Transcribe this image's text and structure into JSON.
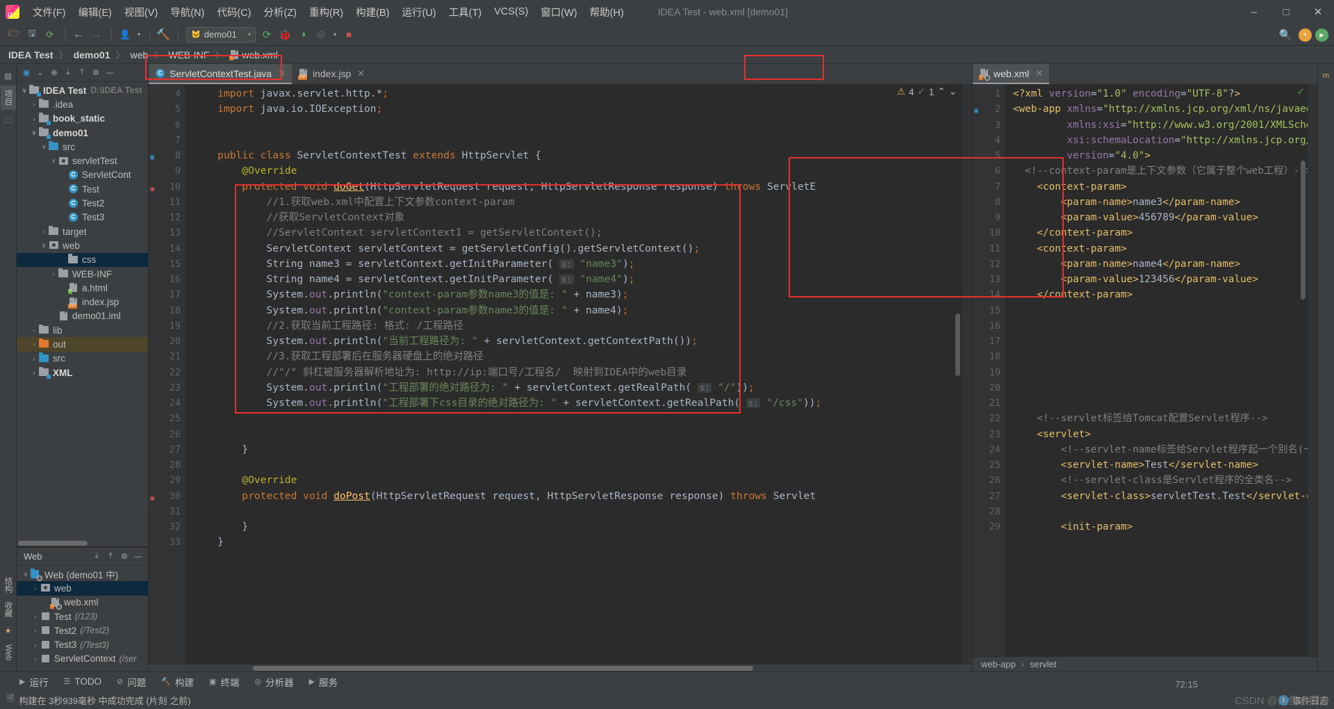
{
  "window": {
    "title": "IDEA Test - web.xml [demo01]",
    "controls": {
      "minimize": "–",
      "maximize": "□",
      "close": "✕"
    }
  },
  "menubar": {
    "logo_icon": "intellij-idea-logo",
    "items": [
      "文件(F)",
      "编辑(E)",
      "视图(V)",
      "导航(N)",
      "代码(C)",
      "分析(Z)",
      "重构(R)",
      "构建(B)",
      "运行(U)",
      "工具(T)",
      "VCS(S)",
      "窗口(W)",
      "帮助(H)"
    ]
  },
  "toolbar": {
    "icons": [
      "open-folder-icon",
      "save-icon",
      "sync-icon"
    ],
    "nav_back_icon": "arrow-left-icon",
    "nav_forward_icon": "arrow-right-icon",
    "profile_icon": "user-icon",
    "build_icon": "hammer-icon",
    "run_config": {
      "label": "demo01",
      "icon": "tomcat-icon",
      "caret": "▾"
    },
    "run_icon": "run-icon",
    "debug_icon": "debug-icon",
    "coverage_icon": "coverage-icon",
    "profiler_icon": "profiler-icon",
    "stop_icon": "stop-icon",
    "search_icon": "search-icon",
    "update_badge": "+",
    "ide_badge": "▶"
  },
  "breadcrumb": {
    "items": [
      "IDEA Test",
      "demo01",
      "web",
      "WEB-INF",
      "web.xml"
    ],
    "separator": "〉"
  },
  "left_strip": {
    "tabs": [
      "项目",
      "结构",
      "收藏",
      "Web"
    ],
    "icons": [
      "project-icon",
      "structure-icon",
      "favorites-icon",
      "web-icon"
    ]
  },
  "project_panel": {
    "title": "项目",
    "header_icons": [
      "select-target-icon",
      "scope-icon",
      "locate-icon",
      "expand-all-icon",
      "collapse-all-icon",
      "settings-gear-icon",
      "hide-icon"
    ],
    "tree": [
      {
        "label": "IDEA Test",
        "suffix": "D:\\IDEA Test",
        "indent": 0,
        "arrow": "∨",
        "icon": "module-folder-icon",
        "bold": true
      },
      {
        "label": ".idea",
        "indent": 1,
        "arrow": "›",
        "icon": "folder-icon"
      },
      {
        "label": "book_static",
        "indent": 1,
        "arrow": "›",
        "icon": "module-folder-icon",
        "bold": true
      },
      {
        "label": "demo01",
        "indent": 1,
        "arrow": "∨",
        "icon": "module-folder-icon",
        "bold": true
      },
      {
        "label": "src",
        "indent": 2,
        "arrow": "∨",
        "icon": "source-folder-icon"
      },
      {
        "label": "servletTest",
        "indent": 3,
        "arrow": "∨",
        "icon": "package-icon"
      },
      {
        "label": "ServletCont",
        "indent": 4,
        "arrow": "",
        "icon": "java-class-icon"
      },
      {
        "label": "Test",
        "indent": 4,
        "arrow": "",
        "icon": "java-class-icon"
      },
      {
        "label": "Test2",
        "indent": 4,
        "arrow": "",
        "icon": "java-class-icon"
      },
      {
        "label": "Test3",
        "indent": 4,
        "arrow": "",
        "icon": "java-class-icon"
      },
      {
        "label": "target",
        "indent": 2,
        "arrow": "›",
        "icon": "folder-icon"
      },
      {
        "label": "web",
        "indent": 2,
        "arrow": "∨",
        "icon": "web-folder-icon"
      },
      {
        "label": "css",
        "indent": 4,
        "arrow": "",
        "icon": "folder-icon",
        "selected": true
      },
      {
        "label": "WEB-INF",
        "indent": 3,
        "arrow": "›",
        "icon": "folder-icon"
      },
      {
        "label": "a.html",
        "indent": 4,
        "arrow": "",
        "icon": "html-file-icon"
      },
      {
        "label": "index.jsp",
        "indent": 4,
        "arrow": "",
        "icon": "jsp-file-icon"
      },
      {
        "label": "demo01.iml",
        "indent": 3,
        "arrow": "",
        "icon": "iml-file-icon"
      },
      {
        "label": "lib",
        "indent": 1,
        "arrow": "›",
        "icon": "folder-icon"
      },
      {
        "label": "out",
        "indent": 1,
        "arrow": "›",
        "icon": "output-folder-icon",
        "highlighted": true
      },
      {
        "label": "src",
        "indent": 1,
        "arrow": "›",
        "icon": "source-folder-icon"
      },
      {
        "label": "XML",
        "indent": 1,
        "arrow": "›",
        "icon": "module-folder-icon",
        "bold": true
      }
    ]
  },
  "web_panel": {
    "title": "Web",
    "header_icons": [
      "expand-all-icon",
      "collapse-all-icon",
      "settings-gear-icon",
      "hide-icon"
    ],
    "tree": [
      {
        "label": "Web (demo01 中)",
        "indent": 0,
        "arrow": "∨",
        "icon": "web-module-icon"
      },
      {
        "label": "web",
        "indent": 1,
        "arrow": "›",
        "icon": "web-folder-icon",
        "selected": true
      },
      {
        "label": "web.xml",
        "indent": 2,
        "arrow": "",
        "icon": "webxml-file-icon"
      },
      {
        "label": "Test",
        "mapping": "(/123)",
        "indent": 1,
        "arrow": "›",
        "icon": "servlet-icon"
      },
      {
        "label": "Test2",
        "mapping": "(/Test2)",
        "indent": 1,
        "arrow": "›",
        "icon": "servlet-icon"
      },
      {
        "label": "Test3",
        "mapping": "(/Test3)",
        "indent": 1,
        "arrow": "›",
        "icon": "servlet-icon"
      },
      {
        "label": "ServletContext",
        "mapping": "(/ser",
        "indent": 1,
        "arrow": "›",
        "icon": "servlet-icon"
      }
    ]
  },
  "editor_left": {
    "tabs": [
      {
        "label": "ServletContextTest.java",
        "icon": "java-class-icon",
        "active": true,
        "close": "✕"
      },
      {
        "label": "index.jsp",
        "icon": "jsp-file-icon",
        "active": false,
        "close": "✕"
      }
    ],
    "inspections": {
      "warning_count": "4",
      "warning_icon": "warning-triangle-icon",
      "ok_count": "1",
      "ok_icon": "check-icon",
      "up_icon": "⌃",
      "down_icon": "⌄"
    },
    "first_line_number": 4,
    "lines": [
      {
        "n": 4,
        "text": "    import javax.servlet.http.*;"
      },
      {
        "n": 5,
        "text": "    import java.io.IOException;"
      },
      {
        "n": 6,
        "text": ""
      },
      {
        "n": 7,
        "text": ""
      },
      {
        "n": 8,
        "text": "    public class ServletContextTest extends HttpServlet {"
      },
      {
        "n": 9,
        "text": "        @Override"
      },
      {
        "n": 10,
        "text": "        protected void doGet(HttpServletRequest request, HttpServletResponse response) throws ServletE"
      },
      {
        "n": 11,
        "text": "            //1.获取web.xml中配置上下文参数context-param"
      },
      {
        "n": 12,
        "text": "            //获取ServletContext对象"
      },
      {
        "n": 13,
        "text": "            //ServletContext servletContext1 = getServletContext();"
      },
      {
        "n": 14,
        "text": "            ServletContext servletContext = getServletConfig().getServletContext();"
      },
      {
        "n": 15,
        "text": "            String name3 = servletContext.getInitParameter( s: \"name3\");"
      },
      {
        "n": 16,
        "text": "            String name4 = servletContext.getInitParameter( s: \"name4\");"
      },
      {
        "n": 17,
        "text": "            System.out.println(\"context-param参数name3的值是: \" + name3);"
      },
      {
        "n": 18,
        "text": "            System.out.println(\"context-param参数name3的值是: \" + name4);"
      },
      {
        "n": 19,
        "text": "            //2.获取当前工程路径: 格式: /工程路径"
      },
      {
        "n": 20,
        "text": "            System.out.println(\"当前工程路径为: \" + servletContext.getContextPath());"
      },
      {
        "n": 21,
        "text": "            //3.获取工程部署后在服务器硬盘上的绝对路径"
      },
      {
        "n": 22,
        "text": "            //\"/\" 斜杠被服务器解析地址为: http://ip:端口号/工程名/  映射到IDEA中的web目录"
      },
      {
        "n": 23,
        "text": "            System.out.println(\"工程部署的绝对路径为: \" + servletContext.getRealPath( s: \"/\"));"
      },
      {
        "n": 24,
        "text": "            System.out.println(\"工程部署下css目录的绝对路径为: \" + servletContext.getRealPath( s: \"/css\"));"
      },
      {
        "n": 25,
        "text": ""
      },
      {
        "n": 26,
        "text": ""
      },
      {
        "n": 27,
        "text": "        }"
      },
      {
        "n": 28,
        "text": ""
      },
      {
        "n": 29,
        "text": "        @Override"
      },
      {
        "n": 30,
        "text": "        protected void doPost(HttpServletRequest request, HttpServletResponse response) throws Servlet"
      },
      {
        "n": 31,
        "text": ""
      },
      {
        "n": 32,
        "text": "        }"
      },
      {
        "n": 33,
        "text": "    }"
      }
    ]
  },
  "editor_right": {
    "tabs": [
      {
        "label": "web.xml",
        "icon": "webxml-file-icon",
        "active": true,
        "close": "✕"
      }
    ],
    "ok_icon": "check-icon",
    "lines": [
      {
        "n": 1,
        "text": "<?xml version=\"1.0\" encoding=\"UTF-8\"?>"
      },
      {
        "n": 2,
        "text": "<web-app xmlns=\"http://xmlns.jcp.org/xml/ns/javaee"
      },
      {
        "n": 3,
        "text": "         xmlns:xsi=\"http://www.w3.org/2001/XMLSche"
      },
      {
        "n": 4,
        "text": "         xsi:schemaLocation=\"http://xmlns.jcp.org/"
      },
      {
        "n": 5,
        "text": "         version=\"4.0\">"
      },
      {
        "n": 6,
        "text": "  <!--context-param是上下文参数（它属于整个web工程）-->"
      },
      {
        "n": 7,
        "text": "    <context-param>"
      },
      {
        "n": 8,
        "text": "        <param-name>name3</param-name>"
      },
      {
        "n": 9,
        "text": "        <param-value>456789</param-value>"
      },
      {
        "n": 10,
        "text": "    </context-param>"
      },
      {
        "n": 11,
        "text": "    <context-param>"
      },
      {
        "n": 12,
        "text": "        <param-name>name4</param-name>"
      },
      {
        "n": 13,
        "text": "        <param-value>123456</param-value>"
      },
      {
        "n": 14,
        "text": "    </context-param>"
      },
      {
        "n": 15,
        "text": ""
      },
      {
        "n": 16,
        "text": ""
      },
      {
        "n": 17,
        "text": ""
      },
      {
        "n": 18,
        "text": ""
      },
      {
        "n": 19,
        "text": ""
      },
      {
        "n": 20,
        "text": ""
      },
      {
        "n": 21,
        "text": ""
      },
      {
        "n": 22,
        "text": "    <!--servlet标签给Tomcat配置Servlet程序-->"
      },
      {
        "n": 23,
        "text": "    <servlet>"
      },
      {
        "n": 24,
        "text": "        <!--servlet-name标签给Servlet程序起一个别名(一"
      },
      {
        "n": 25,
        "text": "        <servlet-name>Test</servlet-name>"
      },
      {
        "n": 26,
        "text": "        <!--servlet-class是Servlet程序的全类名-->"
      },
      {
        "n": 27,
        "text": "        <servlet-class>servletTest.Test</servlet-c"
      },
      {
        "n": 28,
        "text": ""
      },
      {
        "n": 29,
        "text": "        <init-param>"
      }
    ],
    "breadcrumb": [
      "web-app",
      "servlet"
    ],
    "breadcrumb_sep": "›"
  },
  "bottom_bar": {
    "items": [
      {
        "label": "运行",
        "icon": "run-icon"
      },
      {
        "label": "TODO",
        "icon": "todo-icon"
      },
      {
        "label": "问题",
        "icon": "problems-icon"
      },
      {
        "label": "构建",
        "icon": "build-icon"
      },
      {
        "label": "终端",
        "icon": "terminal-icon"
      },
      {
        "label": "分析器",
        "icon": "profiler-icon"
      },
      {
        "label": "服务",
        "icon": "services-icon"
      }
    ]
  },
  "status_bar": {
    "message": "构建在 3秒939毫秒 中成功完成 (片刻 之前)",
    "message_icon": "build-success-icon",
    "event_log": "事件日志",
    "event_count": "1",
    "timestamp": "72:15"
  },
  "watermark": "CSDN @咸鱼会翻身",
  "colors": {
    "accent_blue": "#3592c4",
    "selection": "#0d293e",
    "highlight_box": "#e83030",
    "editor_bg": "#2b2b2b",
    "panel_bg": "#3c3f41",
    "gutter_bg": "#313335",
    "warning": "#d6a94a",
    "ok_green": "#57965c"
  }
}
